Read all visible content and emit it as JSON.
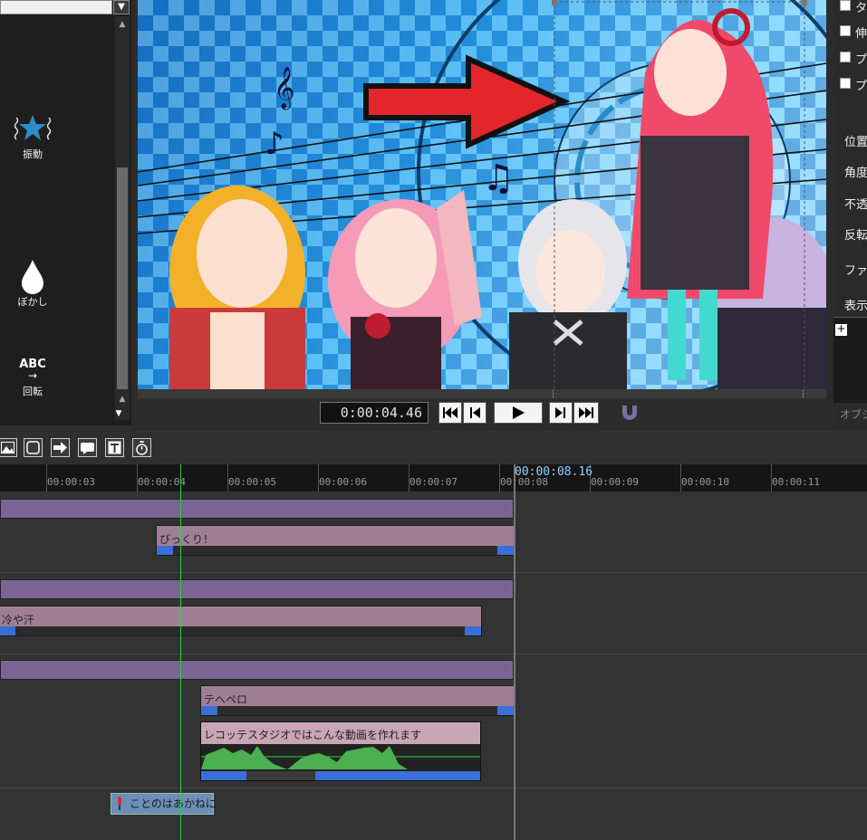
{
  "left_panel": {
    "effects": [
      {
        "label": "振動",
        "icon": "vibration-star-icon"
      },
      {
        "label": "ぼかし",
        "icon": "blur-drop-icon"
      },
      {
        "label": "回転",
        "icon": "rotate-text-icon",
        "icon_text": "ABC"
      }
    ]
  },
  "preview": {
    "timecode": "0:00:04.46"
  },
  "right_panel": {
    "checkboxes": [
      "タ",
      "伸",
      "プ",
      "プ"
    ],
    "properties": [
      "位置",
      "角度",
      "不透",
      "反転",
      "ファイ",
      "表示"
    ],
    "plus_label": "+",
    "bottom_label": "オブジ"
  },
  "timeline": {
    "current_time": "00:00:08.16",
    "ruler_labels": [
      "00:00:03",
      "00:00:04",
      "00:00:05",
      "00:00:06",
      "00:00:07",
      "00:00:08",
      "00:00:09",
      "00:00:10",
      "00:00:11"
    ],
    "clips": {
      "bikkuri": "びっくり！",
      "hiyaase": "冷や汗",
      "tehepero": "テヘペロ",
      "audio": "レコッテスタジオではこんな動画を作れます"
    },
    "marker_label": "ことのはあかねに"
  },
  "colors": {
    "playhead": "#2bd13a",
    "clip": "#a07f96",
    "group": "#7a6494",
    "handle": "#3b6fd8",
    "waveform": "#4caf50"
  }
}
